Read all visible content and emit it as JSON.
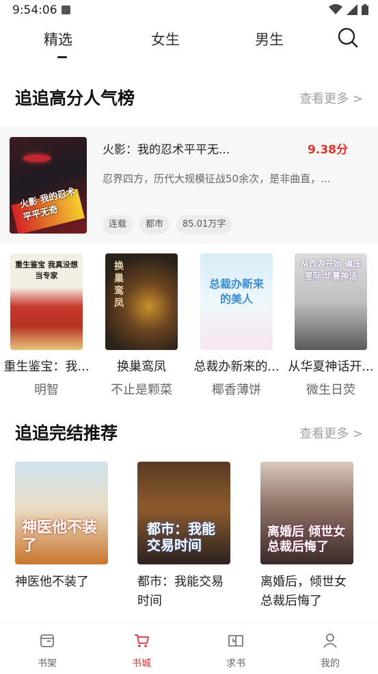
{
  "status": {
    "time": "9:54:06"
  },
  "tabs": [
    {
      "label": "精选"
    },
    {
      "label": "女生"
    },
    {
      "label": "男生"
    }
  ],
  "section_hot": {
    "title": "追追高分人气榜",
    "more": "查看更多 >"
  },
  "featured": {
    "title": "火影：我的忍术平平无...",
    "score": "9.38分",
    "desc": "忍界四方，历代大规模征战50余次，是非曲直，...",
    "tags": [
      "连载",
      "都市",
      "85.01万字"
    ],
    "cover_text": "火影 我的忍术平平无奇"
  },
  "hot_grid": [
    {
      "title": "重生鉴宝：我...",
      "author": "明智",
      "cover_text": "重生鉴宝 我真没想当专家"
    },
    {
      "title": "换巢鸾凤",
      "author": "不止是颗菜",
      "cover_text": "换巢鸾凤"
    },
    {
      "title": "总裁办新来的...",
      "author": "椰香薄饼",
      "cover_text": "总裁办新来的美人"
    },
    {
      "title": "从华夏神话开...",
      "author": "微生日荧",
      "cover_text": "从西游开始 碾压星际 华夏神话"
    }
  ],
  "section_complete": {
    "title": "追追完结推荐",
    "more": "查看更多 >"
  },
  "complete_grid": [
    {
      "title": "神医他不装了",
      "cover_text": "神医他不装了"
    },
    {
      "title": "都市：我能交易时间",
      "cover_text": "都市：我能交易时间"
    },
    {
      "title": "离婚后，倾世女总裁后悔了",
      "cover_text": "离婚后 倾世女总裁后悔了"
    }
  ],
  "bottom_nav": [
    {
      "label": "书架",
      "icon": "bookshelf-icon"
    },
    {
      "label": "书城",
      "icon": "bookstore-cart-icon"
    },
    {
      "label": "求书",
      "icon": "request-book-icon"
    },
    {
      "label": "我的",
      "icon": "profile-icon"
    }
  ],
  "colors": {
    "accent": "#e0302a",
    "muted": "#a0a0a0"
  }
}
